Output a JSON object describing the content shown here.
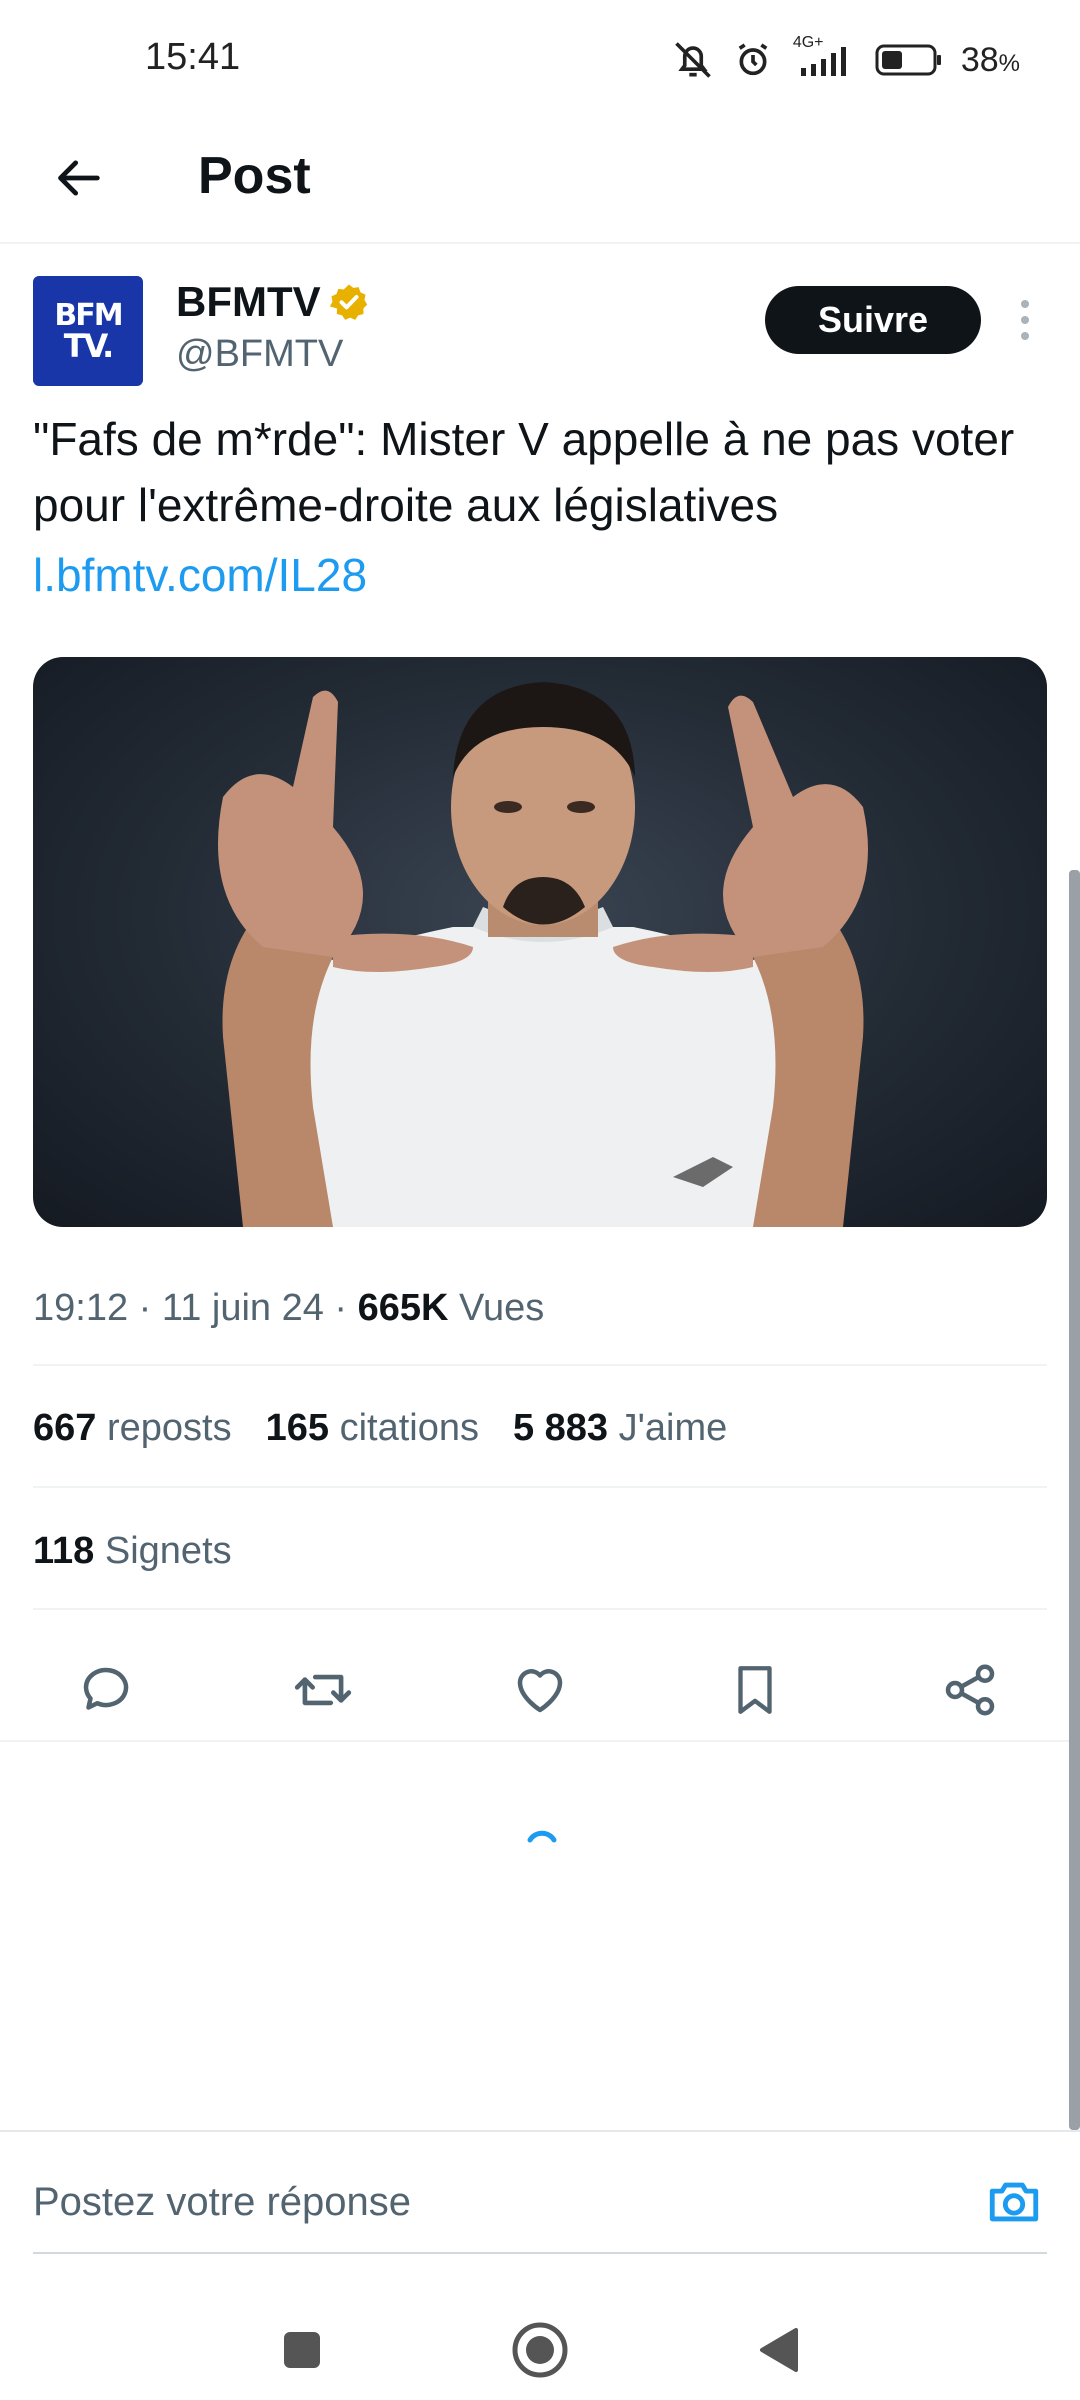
{
  "status_bar": {
    "time": "15:41",
    "network": "4G+",
    "battery_percent": "38",
    "battery_unit": "%",
    "icons": [
      "muted-bell-icon",
      "alarm-icon",
      "signal-icon",
      "battery-icon"
    ]
  },
  "header": {
    "back_icon": "arrow-left-icon",
    "title": "Post"
  },
  "author": {
    "avatar_text_line1": "BFM",
    "avatar_text_line2": "TV.",
    "name": "BFMTV",
    "handle": "@BFMTV",
    "verified": true,
    "verified_color": "#e8b100",
    "follow_label": "Suivre"
  },
  "tweet": {
    "text": "\"Fafs de m*rde\": Mister V appelle à ne pas voter pour l'extrême-droite aux législatives",
    "link": "l.bfmtv.com/IL28"
  },
  "meta": {
    "time": "19:12",
    "date": "11 juin 24",
    "views_count": "665K",
    "views_label": "Vues"
  },
  "stats": {
    "reposts_count": "667",
    "reposts_label": "reposts",
    "quotes_count": "165",
    "quotes_label": "citations",
    "likes_count": "5 883",
    "likes_label": "J'aime",
    "bookmarks_count": "118",
    "bookmarks_label": "Signets"
  },
  "actions": [
    "reply-icon",
    "repost-icon",
    "like-icon",
    "bookmark-icon",
    "share-icon"
  ],
  "reply": {
    "placeholder": "Postez votre réponse"
  },
  "colors": {
    "accent": "#1d9bf0",
    "text": "#0f1419",
    "secondary": "#536471",
    "avatar_bg": "#1936a8"
  }
}
